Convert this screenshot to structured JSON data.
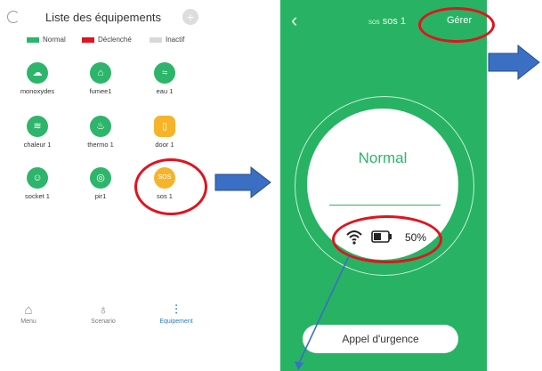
{
  "list_screen": {
    "title": "Liste des équipements",
    "legend": [
      {
        "label": "Normal",
        "color": "#2db56b"
      },
      {
        "label": "Déclenché",
        "color": "#e0141e"
      },
      {
        "label": "Inactif",
        "color": "#d8d8d8"
      }
    ],
    "devices": [
      {
        "label": "monoxydes",
        "icon": "co-cloud-icon",
        "color": "#2db56b"
      },
      {
        "label": "fumee1",
        "icon": "smoke-detector-icon",
        "color": "#2db56b"
      },
      {
        "label": "eau 1",
        "icon": "water-icon",
        "color": "#2db56b"
      },
      {
        "label": "chaleur 1",
        "icon": "heat-icon",
        "color": "#2db56b"
      },
      {
        "label": "thermo 1",
        "icon": "thermometer-icon",
        "color": "#2db56b"
      },
      {
        "label": "door 1",
        "icon": "door-icon",
        "color": "#f5b429"
      },
      {
        "label": "socket 1",
        "icon": "socket-icon",
        "color": "#2db56b"
      },
      {
        "label": "pir1",
        "icon": "pir-sensor-icon",
        "color": "#2db56b"
      },
      {
        "label": "sos 1",
        "icon": "sos-icon",
        "icon_text": "SOS",
        "color": "#f5b429"
      }
    ],
    "tabs": [
      {
        "label": "Menu",
        "icon": "home-icon"
      },
      {
        "label": "Scenario",
        "icon": "lightbulb-icon"
      },
      {
        "label": "Equipement",
        "icon": "sliders-icon",
        "active": true
      }
    ]
  },
  "detail_screen": {
    "back_icon": "chevron-left-icon",
    "title_icon_text": "SOS",
    "title": "sos 1",
    "manage_label": "Gérer",
    "status": "Normal",
    "battery_pct": "50%",
    "call_button": "Appel d'urgence"
  },
  "colors": {
    "green": "#28b264",
    "highlight_red": "#e0141e",
    "arrow_blue": "#3a6fc4",
    "warning_orange": "#f5b429"
  }
}
